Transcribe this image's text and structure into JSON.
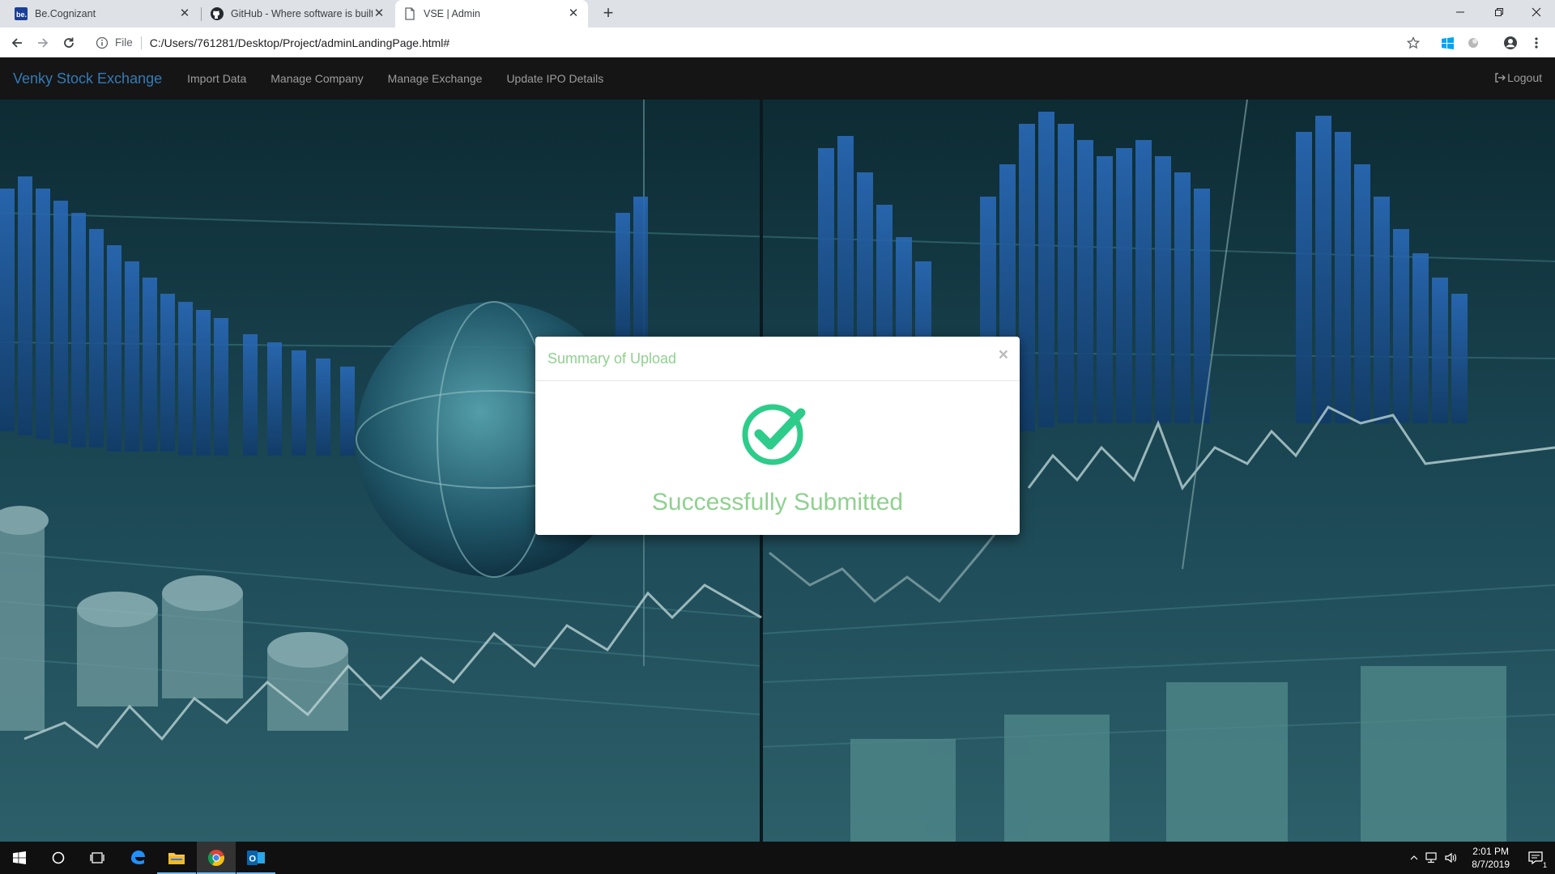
{
  "browser": {
    "tabs": [
      {
        "title": "Be.Cognizant",
        "icon": "be-cognizant-icon",
        "active": false
      },
      {
        "title": "GitHub - Where software is built",
        "icon": "github-icon",
        "active": false
      },
      {
        "title": "VSE | Admin",
        "icon": "page-icon",
        "active": true
      }
    ],
    "address": {
      "scheme_label": "File",
      "url": "C:/Users/761281/Desktop/Project/adminLandingPage.html#"
    }
  },
  "navbar": {
    "brand": "Venky Stock Exchange",
    "links": [
      "Import Data",
      "Manage Company",
      "Manage Exchange",
      "Update IPO Details"
    ],
    "logout": "Logout"
  },
  "modal": {
    "title": "Summary of Upload",
    "close": "×",
    "message": "Successfully Submitted",
    "icon": "check-circle-icon"
  },
  "taskbar": {
    "time": "2:01 PM",
    "date": "8/7/2019",
    "notification_count": "1"
  },
  "colors": {
    "brand": "#337ab7",
    "modal_text": "#8fd18f",
    "check": "#2ecc8a",
    "navbar_bg": "#151515"
  }
}
